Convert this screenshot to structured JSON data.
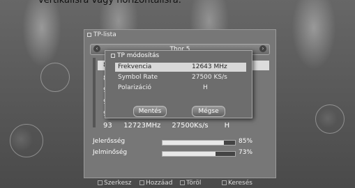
{
  "caption": "vertikálisra vagy horizontálisra.",
  "tp_list": {
    "window_title": "TP-lista",
    "satellite": "Thor 5",
    "rows": [
      {
        "num": "8"
      },
      {
        "num": "8"
      },
      {
        "num": "9"
      },
      {
        "num": "9"
      },
      {
        "num": "9"
      },
      {
        "num": "93",
        "freq": "12723MHz",
        "sr": "27500Ks/s",
        "pol": "H"
      }
    ]
  },
  "tp_edit": {
    "title": "TP módosítás",
    "fields": [
      {
        "label": "Frekvencia",
        "value": "12643 MHz"
      },
      {
        "label": "Symbol Rate",
        "value": "27500 KS/s"
      },
      {
        "label": "Polarizáció",
        "value": "H"
      }
    ],
    "save_label": "Mentés",
    "cancel_label": "Mégse"
  },
  "signal": {
    "strength_label": "Jelerősség",
    "strength_value": "85%",
    "strength_fraction": 0.85,
    "quality_label": "Jelminőség",
    "quality_value": "73%",
    "quality_fraction": 0.73
  },
  "footer": {
    "edit": "Szerkesz",
    "add": "Hozzáad",
    "delete": "Töröl",
    "search": "Keresés"
  }
}
